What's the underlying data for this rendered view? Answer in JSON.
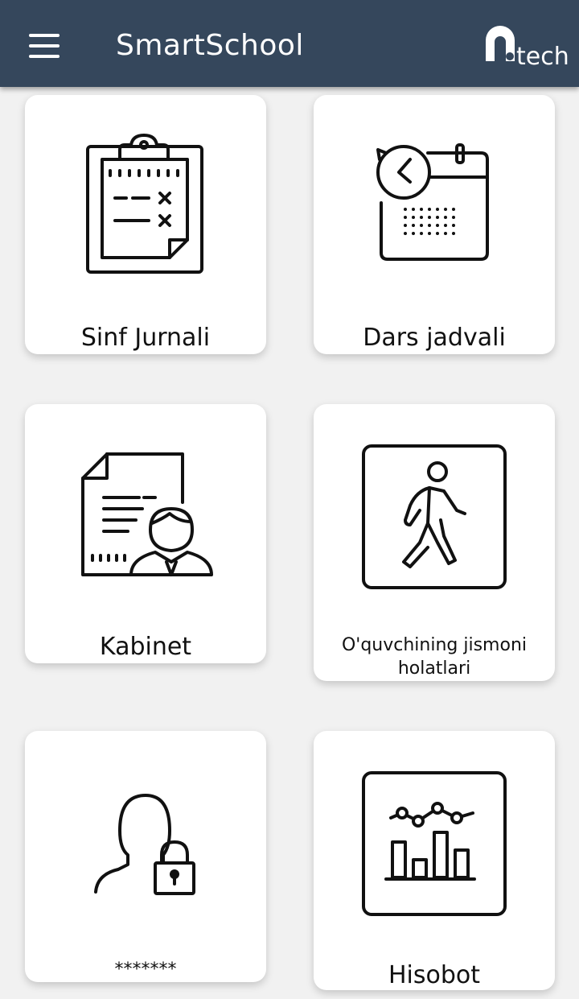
{
  "app": {
    "title": "SmartSchool",
    "logo_text": "tech"
  },
  "cards": [
    {
      "label": "Sinf Jurnali",
      "icon": "clipboard-checklist-icon"
    },
    {
      "label": "Dars jadvali",
      "icon": "calendar-clock-icon"
    },
    {
      "label": "Kabinet",
      "icon": "document-person-icon"
    },
    {
      "label": "O'quvchining jismoni holatlari",
      "icon": "walking-person-icon"
    },
    {
      "label": "*******",
      "icon": "user-lock-icon"
    },
    {
      "label": "Hisobot",
      "icon": "chart-report-icon"
    }
  ],
  "colors": {
    "appbar": "#35475c",
    "background": "#f1f1f1",
    "card": "#ffffff"
  }
}
